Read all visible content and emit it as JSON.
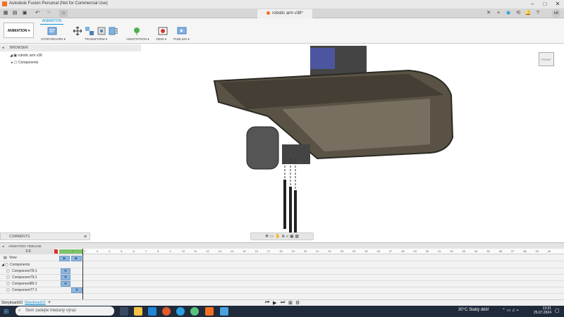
{
  "window": {
    "title": "Autodesk Fusion Personal (Not for Commercial Use)",
    "document_tab": "robotic arm v36*",
    "user_initials": "kR"
  },
  "ribbon": {
    "workspace": "ANIMATION",
    "active_tab": "ANIMATION",
    "groups": [
      "STORYBOARD",
      "TRANSFORM",
      "ANNOTATION",
      "VIEW",
      "PUBLISH"
    ]
  },
  "browser": {
    "header": "BROWSER",
    "root": "robotic arm v36",
    "components": "Components"
  },
  "viewcube": {
    "label": "FRONT"
  },
  "comments": {
    "label": "COMMENTS"
  },
  "timeline": {
    "header": "ANIMATION TIMELINE",
    "current_time": "2.0",
    "ticks": [
      "1",
      "2",
      "3",
      "4",
      "5",
      "6",
      "7",
      "8",
      "9",
      "10",
      "11",
      "12",
      "13",
      "14",
      "15",
      "16",
      "17",
      "18",
      "19",
      "20",
      "21",
      "22",
      "23",
      "24",
      "25",
      "26",
      "27",
      "28",
      "29",
      "30",
      "31",
      "32",
      "33",
      "34",
      "35",
      "36",
      "37",
      "38",
      "39",
      "40"
    ],
    "rows": [
      {
        "label": "View"
      },
      {
        "label": "Components"
      },
      {
        "label": "Component78:1"
      },
      {
        "label": "Component79:1"
      },
      {
        "label": "Component80:1"
      },
      {
        "label": "Component77:1"
      }
    ]
  },
  "storyboards": {
    "inactive": "Storyboard10",
    "active": "Storyboard11",
    "add": "+"
  },
  "taskbar": {
    "search_placeholder": "Sem zadejte hledaný výraz",
    "weather_temp": "30°C",
    "weather_text": "Slabý déšť",
    "time": "13:31",
    "date": "25.07.2024"
  },
  "colors": {
    "accent": "#0696d7",
    "keyframe": "#8fb6dd",
    "taskbar": "#1f2a3a"
  }
}
